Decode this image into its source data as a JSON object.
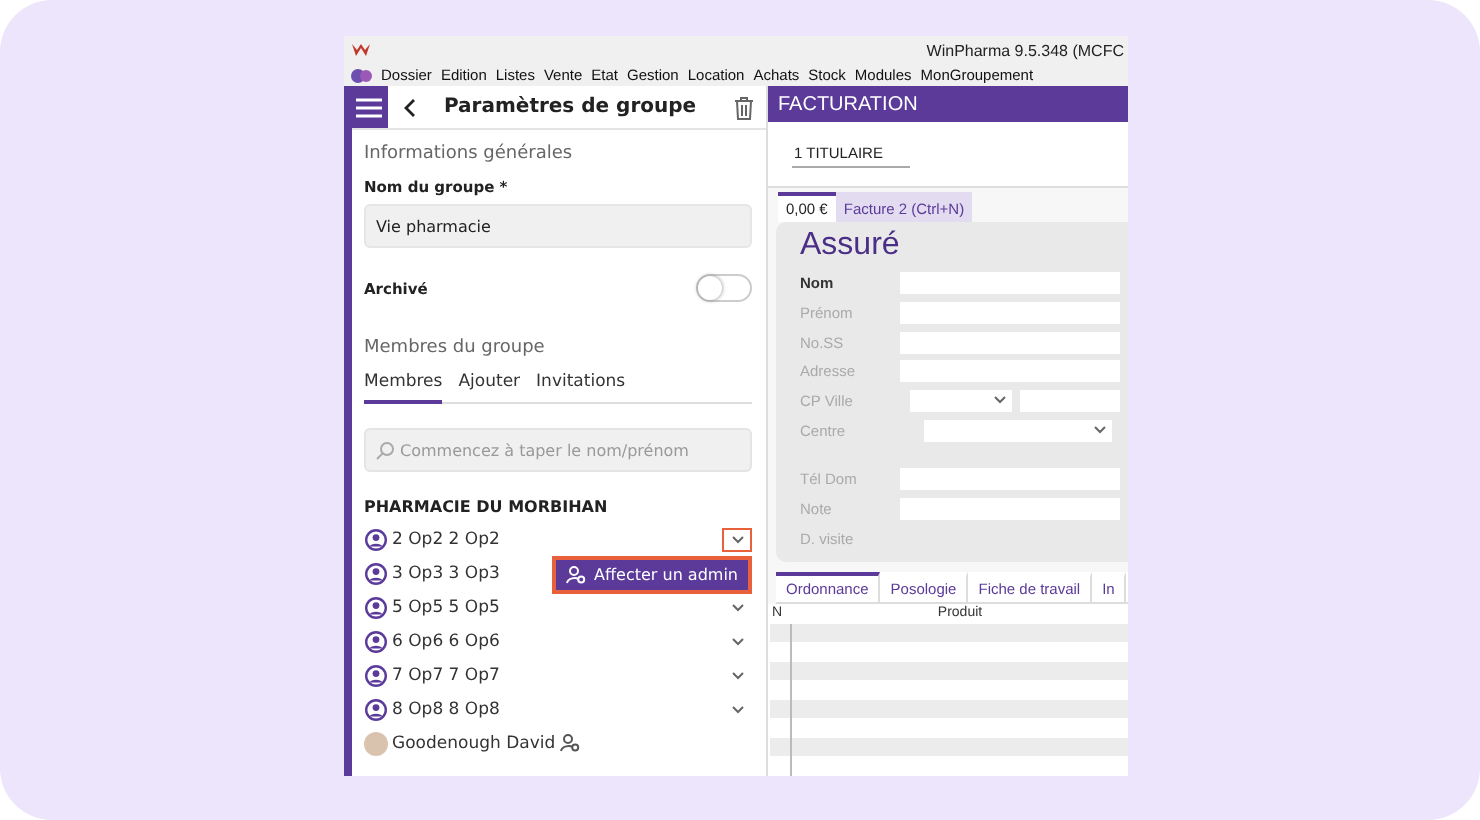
{
  "app": {
    "title": "WinPharma 9.5.348  (MCFC",
    "menu": [
      "Dossier",
      "Edition",
      "Listes",
      "Vente",
      "Etat",
      "Gestion",
      "Location",
      "Achats",
      "Stock",
      "Modules",
      "MonGroupement"
    ]
  },
  "group_panel": {
    "title": "Paramètres de groupe",
    "section_general": "Informations générales",
    "name_label": "Nom du groupe *",
    "name_value": "Vie pharmacie",
    "archived_label": "Archivé",
    "archived": false,
    "section_members": "Membres du groupe",
    "tabs": [
      {
        "label": "Membres",
        "selected": true
      },
      {
        "label": "Ajouter",
        "selected": false
      },
      {
        "label": "Invitations",
        "selected": false
      }
    ],
    "search": {
      "placeholder": "Commencez à taper le nom/prénom"
    },
    "pharmacy": "PHARMACIE DU MORBIHAN",
    "members": [
      {
        "name": "2 Op2 2 Op2",
        "kind": "operator",
        "expandable": true,
        "highlighted": true,
        "admin": false
      },
      {
        "name": "3 Op3 3 Op3",
        "kind": "operator",
        "expandable": false,
        "highlighted": false,
        "admin": false
      },
      {
        "name": "5 Op5 5 Op5",
        "kind": "operator",
        "expandable": true,
        "highlighted": false,
        "admin": false
      },
      {
        "name": "6 Op6 6 Op6",
        "kind": "operator",
        "expandable": true,
        "highlighted": false,
        "admin": false
      },
      {
        "name": "7 Op7 7 Op7",
        "kind": "operator",
        "expandable": true,
        "highlighted": false,
        "admin": false
      },
      {
        "name": "8 Op8 8 Op8",
        "kind": "operator",
        "expandable": true,
        "highlighted": false,
        "admin": false
      },
      {
        "name": "Goodenough David",
        "kind": "photo",
        "expandable": false,
        "highlighted": false,
        "admin": true
      }
    ],
    "popup": {
      "label": "Affecter un admin"
    }
  },
  "billing": {
    "title": "FACTURATION",
    "patient_tab": "1 TITULAIRE",
    "invoice_tabs": [
      {
        "label": "0,00 €",
        "selected": true
      },
      {
        "label": "Facture 2 (Ctrl+N)",
        "selected": false
      }
    ],
    "insured_title": "Assuré",
    "field_groups": [
      [
        {
          "label": "Nom",
          "kind": "text",
          "enabled": true
        },
        {
          "label": "Prénom",
          "kind": "text",
          "enabled": false
        },
        {
          "label": "No.SS",
          "kind": "text",
          "enabled": false
        },
        {
          "label": "Adresse",
          "kind": "text",
          "enabled": false
        },
        {
          "label": "CP Ville",
          "kind": "split",
          "enabled": false
        },
        {
          "label": "Centre",
          "kind": "select",
          "enabled": false
        }
      ],
      [
        {
          "label": "Tél Dom",
          "kind": "text",
          "enabled": false
        },
        {
          "label": "Note",
          "kind": "text",
          "enabled": false
        },
        {
          "label": "D. visite",
          "kind": "none",
          "enabled": false
        }
      ]
    ],
    "bottom_tabs": [
      {
        "label": "Ordonnance",
        "selected": true
      },
      {
        "label": "Posologie",
        "selected": false
      },
      {
        "label": "Fiche de travail",
        "selected": false
      },
      {
        "label": "In",
        "selected": false
      }
    ],
    "table": {
      "columns": [
        "N",
        "Produit"
      ]
    }
  }
}
